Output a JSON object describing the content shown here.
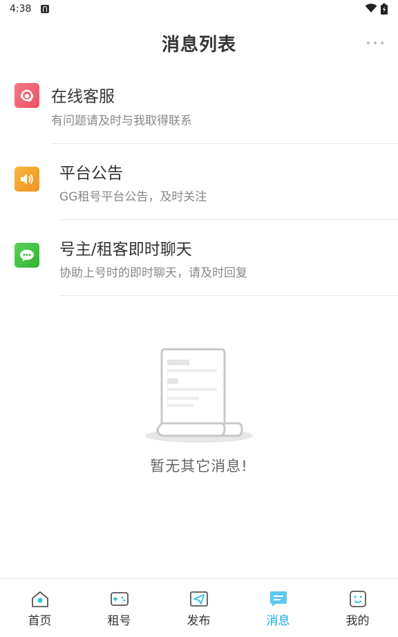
{
  "status_bar": {
    "time": "4:38"
  },
  "header": {
    "title": "消息列表"
  },
  "messages": [
    {
      "title": "在线客服",
      "subtitle": "有问题请及时与我取得联系",
      "icon": "customer-service-icon",
      "color": "#f0596b"
    },
    {
      "title": "平台公告",
      "subtitle": "GG租号平台公告，及时关注",
      "icon": "speaker-icon",
      "color": "#f4a024"
    },
    {
      "title": "号主/租客即时聊天",
      "subtitle": "协助上号时的即时聊天，请及时回复",
      "icon": "chat-bubble-icon",
      "color": "#3ec241"
    }
  ],
  "empty_state": {
    "text": "暂无其它消息!"
  },
  "tabs": [
    {
      "label": "首页",
      "icon": "home-icon",
      "active": false
    },
    {
      "label": "租号",
      "icon": "gamepad-icon",
      "active": false
    },
    {
      "label": "发布",
      "icon": "send-icon",
      "active": false
    },
    {
      "label": "消息",
      "icon": "message-icon",
      "active": true
    },
    {
      "label": "我的",
      "icon": "profile-icon",
      "active": false
    }
  ],
  "colors": {
    "accent": "#1aa5e0",
    "divider": "#e8e8e8"
  }
}
